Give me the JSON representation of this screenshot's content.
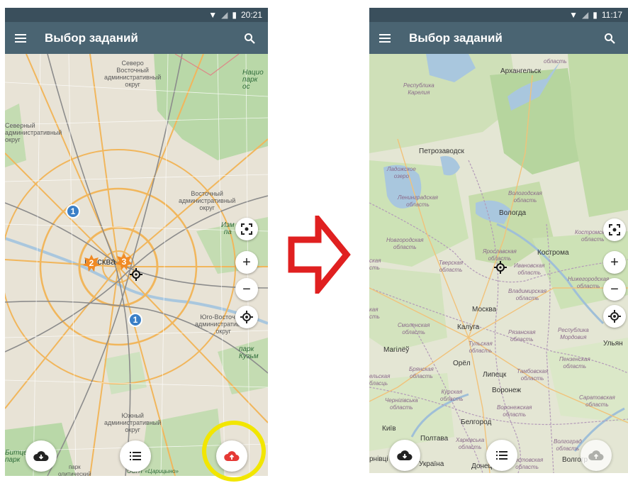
{
  "left": {
    "status": {
      "time": "20:21"
    },
    "toolbar": {
      "title": "Выбор заданий"
    },
    "labels": {
      "north_east_district": "Северо\nВосточный\nадминистративный\nокруг",
      "national_park": "Нацио\nпарк\nос",
      "north_district": "Северный\nадминистративный\nокруг",
      "east_district": "Восточный\nадминистративный\nокруг",
      "izmaylovsky": "Изм\nпа",
      "moscow": "Москва",
      "south_east_district": "Юго-Восточный\nадминистративный\nокруг",
      "kuzminki_park": "парк Кузьм",
      "south_district": "Южный\nадминистративный\nокруг",
      "bitsevsky_park": "Битцев\nпарк",
      "park_bottom": "парк\nолитический",
      "tsaritsyno": "ООПТ «Царицыно»"
    },
    "markers": {
      "blue_1a": "1",
      "orange_2": "2",
      "orange_3": "3",
      "blue_1b": "1"
    },
    "icons": {
      "upload_color": "#e53935"
    }
  },
  "arrow": {
    "color": "#e02020"
  },
  "right": {
    "status": {
      "time": "11:17"
    },
    "toolbar": {
      "title": "Выбор заданий"
    },
    "labels": {
      "oblast_top": "область",
      "arkhangelsk": "Архангельск",
      "karelia": "Республика\nКарелия",
      "petrozavodsk": "Петрозаводск",
      "ladoga": "Ладожское\nозеро",
      "leningrad_obl": "Ленинградская\nобласть",
      "vologda_obl": "Вологодская\nобласть",
      "vologda": "Вологда",
      "kostroma_obl": "Костромская\nобласть",
      "novgorod_obl": "Новгородская\nобласть",
      "yaroslavl_obl": "Ярославская\nобласть",
      "kostroma": "Кострома",
      "tver_obl": "Тверская\nобласть",
      "ivanovo_obl": "Ивановская\nобласть",
      "pskov_obl": "ская\nсть",
      "nizhny_obl": "Нижегородская\nобласть",
      "vladimir_obl": "Владимирская\nобласть",
      "moscow": "Москва",
      "kaya": "кая\nсть",
      "smolensk_obl": "Смоленская\nобласть",
      "kaluga": "Калуга",
      "ryazan_obl": "Рязанская\nобласть",
      "mordovia": "Республика\nМордовия",
      "ulyan": "Ульян",
      "mogilev": "Магілёў",
      "tula_obl": "Тульская\nобласть",
      "oryol": "Орёл",
      "penza_obl": "Пензенская\nобласть",
      "bryansk_obl": "Брянская\nобласть",
      "lipetsk": "Липецк",
      "tambov_obl": "Тамбовская\nобласть",
      "belarus_region": "ельская\nбласць",
      "kursk_obl": "Курская\nобласть",
      "voronezh": "Воронеж",
      "saratov_obl": "Саратовская\nобласть",
      "chernihiv_obl": "Чернігівська\nобласть",
      "voronezh_obl": "Воронежская\nобласть",
      "belgorod": "Белгород",
      "kyiv": "Київ",
      "poltava": "Полтава",
      "kharkiv_obl": "Харківська\nобласть",
      "volgograd_obl": "Волгоград\nобласть",
      "ternivka": "рнівці",
      "ukraine": "Україна",
      "donetsk": "Донецьк",
      "rostov_obl": "Ростовская\nобласть",
      "volgograd": "Волгогр"
    }
  }
}
